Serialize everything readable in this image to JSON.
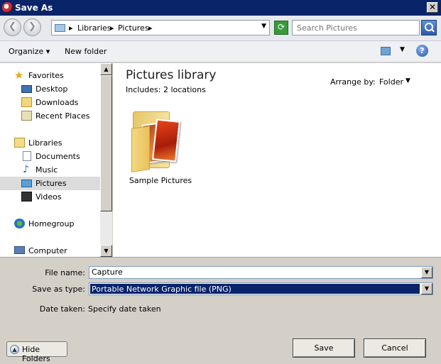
{
  "window": {
    "title": "Save As",
    "close_glyph": "✕"
  },
  "address": {
    "back_glyph": "❮",
    "forward_glyph": "❯",
    "crumbs": [
      "Libraries",
      "Pictures"
    ],
    "crumb_sep": "▸",
    "dropdown_glyph": "▼",
    "refresh_glyph": "⟳",
    "search_placeholder": "Search Pictures"
  },
  "toolbar": {
    "organize": "Organize ▾",
    "new_folder": "New folder",
    "help_glyph": "?",
    "view_arrow": "▼"
  },
  "nav": {
    "favorites": {
      "header": "Favorites",
      "items": [
        "Desktop",
        "Downloads",
        "Recent Places"
      ]
    },
    "libraries": {
      "header": "Libraries",
      "items": [
        "Documents",
        "Music",
        "Pictures",
        "Videos"
      ]
    },
    "homegroup": "Homegroup",
    "computer": "Computer",
    "selected": "Pictures",
    "scroll_up_glyph": "▲",
    "scroll_down_glyph": "▼"
  },
  "content": {
    "title": "Pictures library",
    "includes": "Includes:  2 locations",
    "arrange_label": "Arrange by:",
    "arrange_value": "Folder",
    "arrange_arrow": "▼",
    "items": [
      {
        "name": "Sample Pictures",
        "icon": "folder-with-pictures-icon"
      }
    ]
  },
  "form": {
    "file_name_label": "File name:",
    "file_name_value": "Capture",
    "save_type_label": "Save as type:",
    "save_type_value": "Portable Network Graphic file (PNG)",
    "date_taken_label": "Date taken:",
    "date_taken_value": "Specify date taken",
    "combo_arrow": "▼"
  },
  "buttons": {
    "hide_folders": "Hide Folders",
    "hide_glyph": "▲",
    "save": "Save",
    "cancel": "Cancel"
  },
  "colors": {
    "title_bar": "#0a246a",
    "selection": "#0a246a",
    "nav_selected": "#dcdcdc"
  }
}
